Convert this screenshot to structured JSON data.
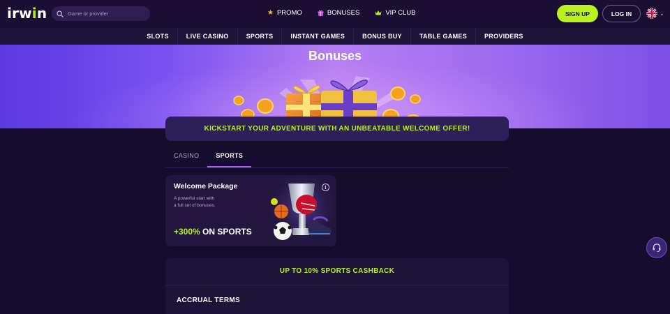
{
  "header": {
    "logo": {
      "main": "irw",
      "accent": "i",
      "rest": "n"
    },
    "search": {
      "placeholder": "Game or provider",
      "icon": "search-icon"
    },
    "nav": [
      {
        "label": "PROMO",
        "icon": "star-icon"
      },
      {
        "label": "BONUSES",
        "icon": "gift-icon"
      },
      {
        "label": "VIP CLUB",
        "icon": "crown-icon"
      }
    ],
    "signup_label": "SIGN UP",
    "login_label": "LOG IN",
    "language_icon": "uk-flag-icon"
  },
  "subnav": [
    "SLOTS",
    "LIVE CASINO",
    "SPORTS",
    "INSTANT GAMES",
    "BONUS BUY",
    "TABLE GAMES",
    "PROVIDERS"
  ],
  "hero": {
    "title": "Bonuses"
  },
  "promo_strip": "KICKSTART YOUR ADVENTURE WITH AN UNBEATABLE WELCOME OFFER!",
  "tabs": [
    {
      "label": "CASINO",
      "active": false
    },
    {
      "label": "SPORTS",
      "active": true
    }
  ],
  "welcome_card": {
    "title": "Welcome Package",
    "description_line1": "A powerful start with",
    "description_line2": "a full set of bonuses.",
    "offer_highlight": "+300%",
    "offer_rest": " ON SPORTS"
  },
  "cashback": {
    "title": "UP TO 10% SPORTS CASHBACK",
    "section_title": "ACCRUAL TERMS"
  },
  "colors": {
    "accent": "#b8f31f",
    "background": "#160c2e",
    "header": "#1a0f33",
    "card": "#22163f"
  }
}
